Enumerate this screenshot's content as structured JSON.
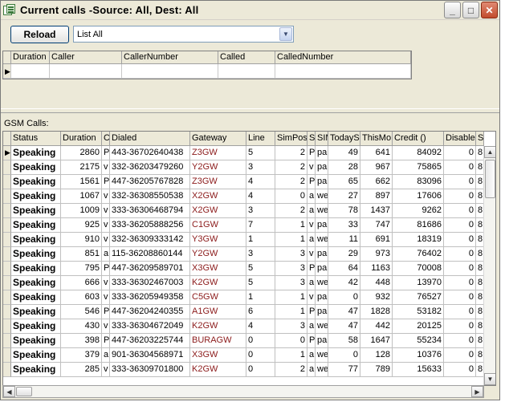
{
  "window": {
    "title": "Current calls -Source: All, Dest: All",
    "minimize": "_",
    "maximize": "□",
    "close": "✕"
  },
  "toolbar": {
    "reload_label": "Reload",
    "filter_selected": "List All",
    "dropdown_arrow": "▼"
  },
  "grid1": {
    "indicator": "▶",
    "columns": [
      "Duration",
      "Caller",
      "CallerNumber",
      "Called",
      "CalledNumber"
    ]
  },
  "gsm": {
    "label": "GSM Calls:",
    "columns": [
      "Status",
      "Duration",
      "C",
      "Dialed",
      "Gateway",
      "Line",
      "SimPos",
      "S",
      "SIM",
      "TodayS",
      "ThisMo",
      "Credit ()",
      "Disable",
      "S"
    ],
    "indicator": "▶",
    "rows": [
      [
        "Speaking",
        "2860",
        "P",
        "443-36702640438",
        "Z3GW",
        "5",
        "2",
        "P",
        "par",
        "49",
        "641",
        "84092",
        "0",
        "8"
      ],
      [
        "Speaking",
        "2175",
        "v",
        "332-36203479260",
        "Y2GW",
        "3",
        "2",
        "v",
        "par",
        "28",
        "967",
        "75865",
        "0",
        "8"
      ],
      [
        "Speaking",
        "1561",
        "P",
        "447-36205767828",
        "Z3GW",
        "4",
        "2",
        "P",
        "par",
        "65",
        "662",
        "83096",
        "0",
        "8"
      ],
      [
        "Speaking",
        "1067",
        "v",
        "332-36308550538",
        "X2GW",
        "4",
        "0",
        "a",
        "we",
        "27",
        "897",
        "17606",
        "0",
        "8"
      ],
      [
        "Speaking",
        "1009",
        "v",
        "333-36306468794",
        "X2GW",
        "3",
        "2",
        "a",
        "we",
        "78",
        "1437",
        "9262",
        "0",
        "8"
      ],
      [
        "Speaking",
        "925",
        "v",
        "333-36205888256",
        "C1GW",
        "7",
        "1",
        "v",
        "par",
        "33",
        "747",
        "81686",
        "0",
        "8"
      ],
      [
        "Speaking",
        "910",
        "v",
        "332-36309333142",
        "Y3GW",
        "1",
        "1",
        "a",
        "we",
        "11",
        "691",
        "18319",
        "0",
        "8"
      ],
      [
        "Speaking",
        "851",
        "a",
        "115-36208860144",
        "Y2GW",
        "3",
        "3",
        "v",
        "par",
        "29",
        "973",
        "76402",
        "0",
        "8"
      ],
      [
        "Speaking",
        "795",
        "P",
        "447-36209589701",
        "X3GW",
        "5",
        "3",
        "P",
        "par",
        "64",
        "1163",
        "70008",
        "0",
        "8"
      ],
      [
        "Speaking",
        "666",
        "v",
        "333-36302467003",
        "K2GW",
        "5",
        "3",
        "a",
        "we",
        "42",
        "448",
        "13970",
        "0",
        "8"
      ],
      [
        "Speaking",
        "603",
        "v",
        "333-36205949358",
        "C5GW",
        "1",
        "1",
        "v",
        "par",
        "0",
        "932",
        "76527",
        "0",
        "8"
      ],
      [
        "Speaking",
        "546",
        "P",
        "447-36204240355",
        "A1GW",
        "6",
        "1",
        "P",
        "par",
        "47",
        "1828",
        "53182",
        "0",
        "8"
      ],
      [
        "Speaking",
        "430",
        "v",
        "333-36304672049",
        "K2GW",
        "4",
        "3",
        "a",
        "we",
        "47",
        "442",
        "20125",
        "0",
        "8"
      ],
      [
        "Speaking",
        "398",
        "P",
        "447-36203225744",
        "BURAGW",
        "0",
        "0",
        "P",
        "par",
        "58",
        "1647",
        "55234",
        "0",
        "8"
      ],
      [
        "Speaking",
        "379",
        "a",
        "901-36304568971",
        "X3GW",
        "0",
        "1",
        "a",
        "we",
        "0",
        "128",
        "10376",
        "0",
        "8"
      ],
      [
        "Speaking",
        "285",
        "v",
        "333-36309701800",
        "K2GW",
        "0",
        "2",
        "a",
        "we",
        "77",
        "789",
        "15633",
        "0",
        "8"
      ]
    ]
  },
  "scroll": {
    "up": "▲",
    "down": "▼",
    "left": "◀",
    "right": "▶"
  }
}
